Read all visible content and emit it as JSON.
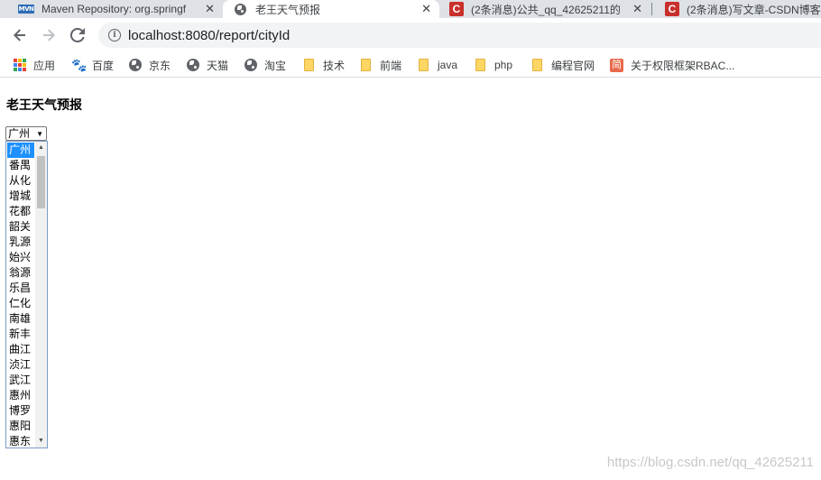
{
  "browser": {
    "tabs": [
      {
        "title": "Maven Repository: org.springf",
        "icon": "maven-icon",
        "active": false
      },
      {
        "title": "老王天气预报",
        "icon": "globe-icon",
        "active": true
      },
      {
        "title": "(2条消息)公共_qq_42625211的",
        "icon": "csdn-icon",
        "active": false
      },
      {
        "title": "(2条消息)写文章-CSDN博客",
        "icon": "csdn-icon",
        "active": false
      }
    ],
    "close_glyph": "✕",
    "url": "localhost:8080/report/cityId",
    "bookmarks": [
      {
        "label": "应用",
        "icon": "apps-icon"
      },
      {
        "label": "百度",
        "icon": "baidu-paw-icon"
      },
      {
        "label": "京东",
        "icon": "globe-icon"
      },
      {
        "label": "天猫",
        "icon": "globe-icon"
      },
      {
        "label": "淘宝",
        "icon": "globe-icon"
      },
      {
        "label": "技术",
        "icon": "folder-icon"
      },
      {
        "label": "前端",
        "icon": "folder-icon"
      },
      {
        "label": "java",
        "icon": "folder-icon"
      },
      {
        "label": "php",
        "icon": "folder-icon"
      },
      {
        "label": "编程官网",
        "icon": "folder-icon"
      },
      {
        "label": "关于权限框架RBAC...",
        "icon": "jianshu-icon"
      }
    ]
  },
  "page": {
    "heading": "老王天气预报",
    "city_select": {
      "selected": "广州",
      "options": [
        "广州",
        "番禺",
        "从化",
        "增城",
        "花都",
        "韶关",
        "乳源",
        "始兴",
        "翁源",
        "乐昌",
        "仁化",
        "南雄",
        "新丰",
        "曲江",
        "浈江",
        "武江",
        "惠州",
        "博罗",
        "惠阳",
        "惠东"
      ]
    }
  },
  "watermark": "https://blog.csdn.net/qq_42625211",
  "colors": {
    "tabstrip": "#dee1e6",
    "selection": "#1e90ff",
    "folder": "#fdd663",
    "csdn": "#c9302c",
    "jianshu": "#e8694b",
    "baidu": "#2f6df2"
  }
}
